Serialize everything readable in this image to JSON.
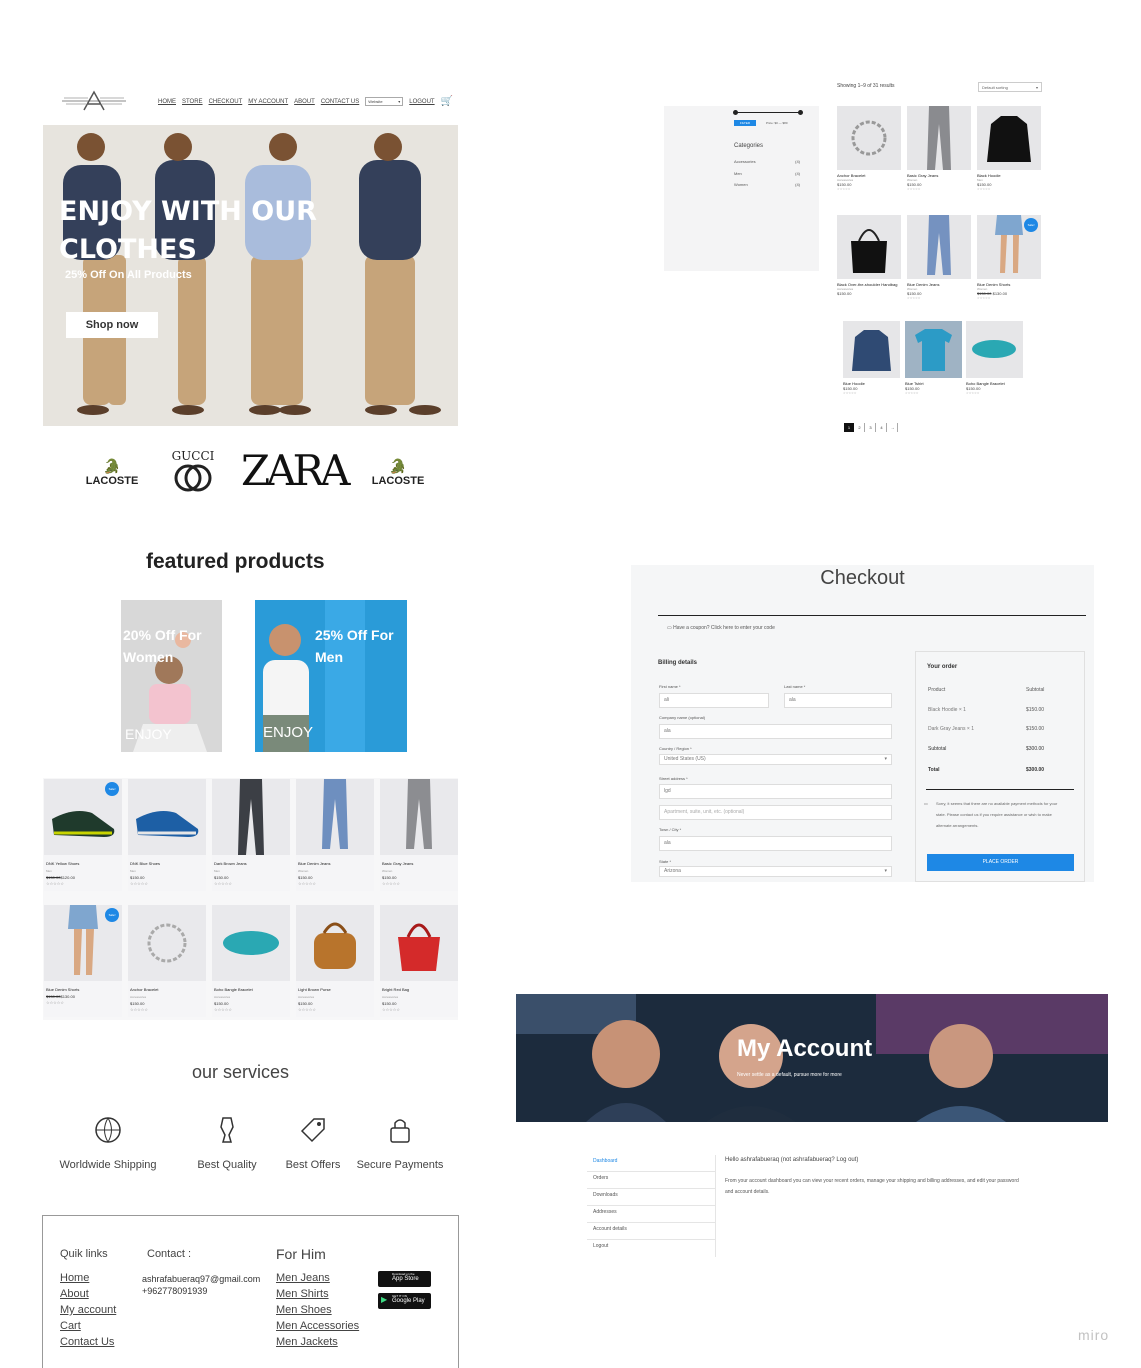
{
  "header": {
    "nav": [
      "HOME",
      "STORE",
      "CHECKOUT",
      "MY ACCOUNT",
      "ABOUT",
      "CONTACT US"
    ],
    "currency": "Website",
    "logout": "LOGOUT"
  },
  "hero": {
    "title_line1": "ENJOY WITH OUR",
    "title_line2": "CLOTHES",
    "subtitle": "25% Off On All Products",
    "cta": "Shop now"
  },
  "brands": [
    "LACOSTE",
    "GUCCI",
    "ZARA",
    "LACOSTE"
  ],
  "featured": {
    "title": "featured products",
    "promo_women": "20% Off For Women",
    "promo_men": "25% Off For Men",
    "enjoy": "ENJOY"
  },
  "products": [
    {
      "name": "DNK Yellow Shoes",
      "cat": "Men",
      "old": "$150.00",
      "price": "$120.00",
      "sale": true
    },
    {
      "name": "DNK Blue Shoes",
      "cat": "Men",
      "price": "$150.00"
    },
    {
      "name": "Dark Brown Jeans",
      "cat": "Men",
      "price": "$150.00"
    },
    {
      "name": "Blue Denim Jeans",
      "cat": "Women",
      "price": "$150.00"
    },
    {
      "name": "Basic Gray Jeans",
      "cat": "Women",
      "price": "$150.00"
    },
    {
      "name": "Blue Denim Shorts",
      "cat": "Women",
      "old": "$150.00",
      "price": "$130.00",
      "sale": true
    },
    {
      "name": "Anchor Bracelet",
      "cat": "Accessories",
      "price": "$150.00"
    },
    {
      "name": "Boho Bangle Bracelet",
      "cat": "Accessories",
      "price": "$150.00"
    },
    {
      "name": "Light Brown Purse",
      "cat": "Accessories",
      "price": "$150.00"
    },
    {
      "name": "Bright Red Bag",
      "cat": "Accessories",
      "price": "$150.00"
    }
  ],
  "sale_badge": "Sale!",
  "stars": "☆☆☆☆☆",
  "services": {
    "title": "our services",
    "items": [
      "Worldwide Shipping",
      "Best Quality",
      "Best Offers",
      "Secure Payments"
    ]
  },
  "footer": {
    "quick_title": "Quik links",
    "quick": [
      "Home",
      "About",
      "My account",
      "Cart",
      "Contact Us"
    ],
    "contact_title": "Contact :",
    "email": "ashrafabueraq97@gmail.com",
    "phone": "+962778091939",
    "him_title": "For Him",
    "him": [
      "Men Jeans",
      "Men Shirts",
      "Men Shoes",
      "Men Accessories",
      "Men Jackets"
    ],
    "appstore_small": "Download on the",
    "appstore": "App Store",
    "gplay_small": "GET IT ON",
    "gplay": "Google Play"
  },
  "shop": {
    "results": "Showing 1–9 of 31 results",
    "sort": "Default sorting",
    "filter_btn": "FILTER",
    "price_range": "Price: $0 — $80",
    "cats_title": "Categories",
    "cats": [
      {
        "n": "Accessories",
        "c": "(4)"
      },
      {
        "n": "Men",
        "c": "(4)"
      },
      {
        "n": "Women",
        "c": "(4)"
      }
    ],
    "items": [
      {
        "n": "Anchor Bracelet",
        "c": "Accessories",
        "p": "$150.00"
      },
      {
        "n": "Basic Gray Jeans",
        "c": "Women",
        "p": "$150.00"
      },
      {
        "n": "Black Hoodie",
        "c": "Men",
        "p": "$150.00"
      },
      {
        "n": "Black Over-the-shoulder Handbag",
        "c": "Accessories",
        "p": "$150.00"
      },
      {
        "n": "Blue Denim Jeans",
        "c": "Women",
        "p": "$150.00"
      },
      {
        "n": "Blue Denim Shorts",
        "c": "Women",
        "p": "$130.00",
        "old": "$150.00",
        "sale": true
      },
      {
        "n": "Blue Hoodie",
        "c": "Men",
        "p": "$150.00"
      },
      {
        "n": "Blue Tshirt",
        "c": "Men",
        "p": "$150.00"
      },
      {
        "n": "Boho Bangle Bracelet",
        "c": "Accessories",
        "p": "$150.00"
      }
    ],
    "pages": [
      "1",
      "2",
      "3",
      "4",
      "→"
    ]
  },
  "checkout": {
    "title": "Checkout",
    "coupon": "Have a coupon? Click here to enter your code",
    "billing": "Billing details",
    "first": "First name *",
    "first_val": "ali",
    "last": "Last name *",
    "last_val": "ala",
    "company": "Company name (optional)",
    "company_val": "ala",
    "country": "Country / Region *",
    "country_val": "United States (US)",
    "street": "Street address *",
    "street_val": "lgd",
    "apt": "Apartment, suite, unit, etc. (optional)",
    "town": "Town / City *",
    "town_val": "ala",
    "state": "State *",
    "state_val": "Arizona",
    "order_title": "Your order",
    "col_product": "Product",
    "col_sub": "Subtotal",
    "rows": [
      {
        "p": "Black Hoodie × 1",
        "s": "$150.00"
      },
      {
        "p": "Dark Gray Jeans × 1",
        "s": "$150.00"
      }
    ],
    "subtotal_l": "Subtotal",
    "subtotal": "$300.00",
    "total_l": "Total",
    "total": "$300.00",
    "notice": "Sorry, it seems that there are no available payment methods for your state. Please contact us if you require assistance or wish to make alternate arrangements.",
    "place": "PLACE ORDER"
  },
  "account": {
    "title": "My Account",
    "subtitle": "Never settle as a default, pursue more for more",
    "menu": [
      "Dashboard",
      "Orders",
      "Downloads",
      "Addresses",
      "Account details",
      "Logout"
    ],
    "hello": "Hello ashrafabueraq (not ashrafabueraq? Log out)",
    "desc": "From your account dashboard you can view your recent orders, manage your shipping and billing addresses, and edit your password and account details."
  },
  "watermark": "miro"
}
